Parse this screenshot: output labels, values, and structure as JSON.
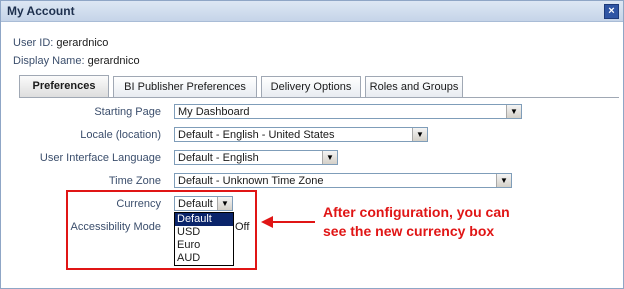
{
  "dialog": {
    "title": "My Account",
    "close_glyph": "×"
  },
  "user": {
    "id_label": "User ID:",
    "id_value": "gerardnico",
    "display_label": "Display Name:",
    "display_value": "gerardnico"
  },
  "tabs": [
    {
      "label": "Preferences",
      "active": true
    },
    {
      "label": "BI Publisher Preferences",
      "active": false
    },
    {
      "label": "Delivery Options",
      "active": false
    },
    {
      "label": "Roles and Groups",
      "active": false
    }
  ],
  "form": {
    "starting_page": {
      "label": "Starting Page",
      "value": "My Dashboard"
    },
    "locale": {
      "label": "Locale (location)",
      "value": "Default - English - United States"
    },
    "ui_language": {
      "label": "User Interface Language",
      "value": "Default - English"
    },
    "time_zone": {
      "label": "Time Zone",
      "value": "Default - Unknown Time Zone"
    },
    "currency": {
      "label": "Currency",
      "value": "Default",
      "options": [
        "Default",
        "USD",
        "Euro",
        "AUD"
      ],
      "highlighted_option": "Default"
    },
    "accessibility": {
      "label": "Accessibility Mode",
      "value_partial": "Off"
    }
  },
  "annotation": {
    "line1": "After configuration, you can",
    "line2": "see the new currency box",
    "color": "#e01515"
  },
  "icons": {
    "dropdown_arrow": "▼"
  }
}
